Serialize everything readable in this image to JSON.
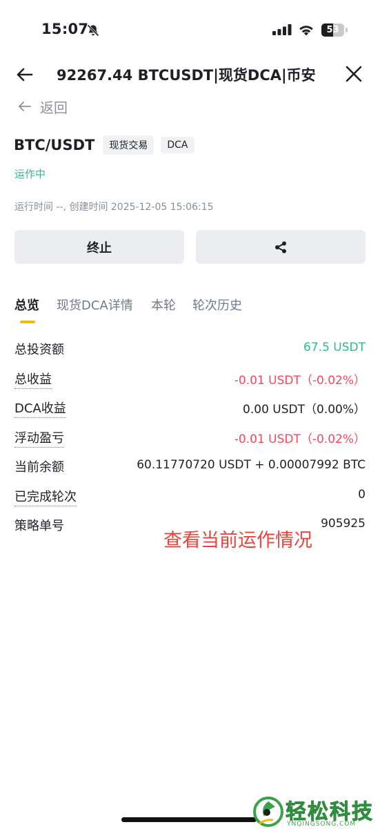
{
  "status_bar": {
    "time": "15:07",
    "battery": "53",
    "battery_level": 0.53,
    "icons": [
      "bell-slash-icon",
      "signal-icon",
      "wifi-icon",
      "battery-icon"
    ]
  },
  "header": {
    "title": "92267.44 BTCUSDT|现货DCA|币安",
    "back_icon": "arrow-left-icon",
    "close_icon": "close-icon"
  },
  "nav": {
    "return_label": "返回"
  },
  "strategy": {
    "pair": "BTC/USDT",
    "tags": [
      "现货交易",
      "DCA"
    ],
    "status": "运作中",
    "meta": "运行时间 --, 创建时间 2025-12-05 15:06:15"
  },
  "actions": {
    "stop_label": "终止",
    "share_icon": "share-icon"
  },
  "tabs": [
    {
      "label": "总览",
      "active": true
    },
    {
      "label": "现货DCA详情",
      "active": false
    },
    {
      "label": "本轮",
      "active": false
    },
    {
      "label": "轮次历史",
      "active": false
    }
  ],
  "overview": [
    {
      "label": "总投资额",
      "value": "67.5  USDT",
      "tone": "green",
      "dotted": false
    },
    {
      "label": "总收益",
      "value": "-0.01  USDT（-0.02%）",
      "tone": "red",
      "dotted": true
    },
    {
      "label": "DCA收益",
      "value": "0.00  USDT（0.00%）",
      "tone": "normal",
      "dotted": true
    },
    {
      "label": "浮动盈亏",
      "value": "-0.01  USDT（-0.02%）",
      "tone": "red",
      "dotted": true
    },
    {
      "label": "当前余额",
      "value": "60.11770720 USDT + 0.00007992 BTC",
      "tone": "normal",
      "dotted": false
    },
    {
      "label": "已完成轮次",
      "value": "0",
      "tone": "normal",
      "dotted": true
    },
    {
      "label": "策略单号",
      "value": "905925",
      "tone": "normal",
      "dotted": false
    }
  ],
  "annotation": "查看当前运作情况",
  "watermark": {
    "text": "轻松科技",
    "sub": "YNQINGSONG.COM"
  },
  "colors": {
    "accent": "#f0b90b",
    "green": "#2ebd85",
    "red": "#f6465d",
    "annotation": "#e8443a",
    "button_bg": "#eaecef",
    "muted": "#848e9c"
  }
}
